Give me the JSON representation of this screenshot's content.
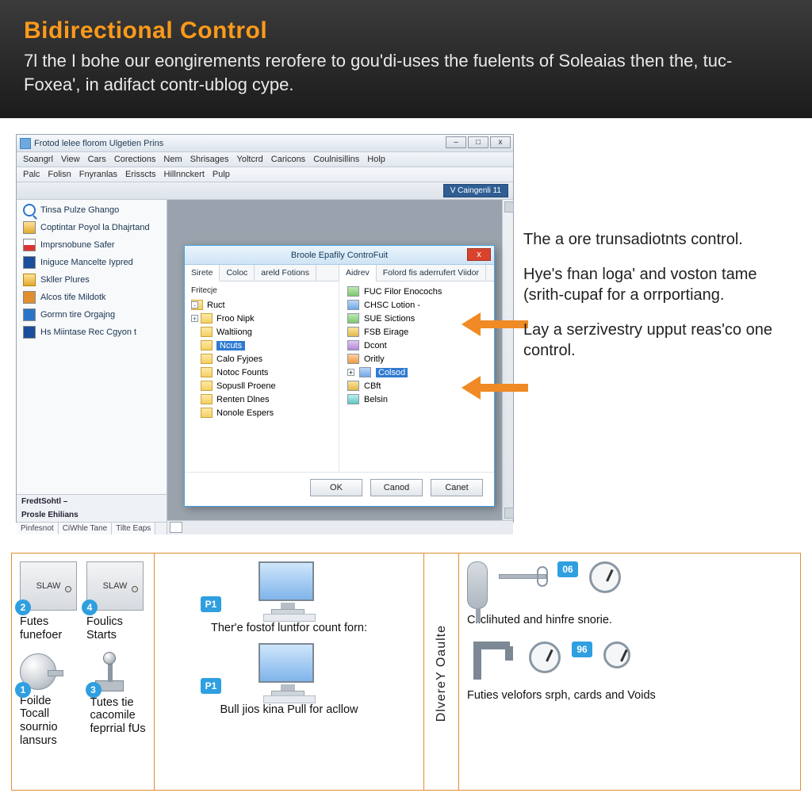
{
  "hero": {
    "title": "Bidirectional Control",
    "body": "7l the I bohe our eongirements rerofere to gou'di-uses the fuelents of Soleaias then the, tuc- Foxea', in adifact contr-ublog cype."
  },
  "hostWindow": {
    "title": "Frotod lelee florom Ulgetien Prins",
    "winButtons": {
      "min": "–",
      "max": "□",
      "close": "x"
    },
    "menu": [
      "Soangrl",
      "View",
      "Cars",
      "Corections",
      "Nem",
      "Shrisages",
      "Yoltcrd",
      "Caricons",
      "Coulnisillins",
      "Holp"
    ],
    "innerMenu": [
      "Palc",
      "Folisn",
      "Fnyranlas",
      "Erisscts",
      "Hillnnckert",
      "Pulp"
    ],
    "categoryBtn": "V Caingenli  11",
    "side": [
      "Tinsa Pulze Ghango",
      "Coptintar Poyol la Dhajrtand",
      "Imprsnobune Safer",
      "Iniguce Mancelte Iypred",
      "Skller Plures",
      "Alcos tife Mildotk",
      "Gormn tire Orgajng",
      "Hs Miintase Rec Cgyon t"
    ],
    "sideGroupA": "FredtSohtl –",
    "sideGroupB": "Prosle Ehilians",
    "sideTabs": [
      "Pinfesnot",
      "CiWhle Tane",
      "Tilte Eaps"
    ]
  },
  "dialog": {
    "title": "Broole Epafily ControFuit",
    "close": "x",
    "leftTabs": [
      "Sirete",
      "Coloc",
      "areld Fotions"
    ],
    "rightTabs": [
      "Aidrev",
      "Folord fis aderrufert Viidor"
    ],
    "leftHeader": "Fritecje",
    "tree": [
      {
        "label": "Ruct",
        "root": true,
        "exp": "-"
      },
      {
        "label": "Froo Nipk",
        "exp": "+"
      },
      {
        "label": "Waltiiong"
      },
      {
        "label": "Ncuts",
        "sel": true
      },
      {
        "label": "Calo Fyjoes"
      },
      {
        "label": "Notoc Founts"
      },
      {
        "label": "Sopusll Proene"
      },
      {
        "label": "Renten Dlnes"
      },
      {
        "label": "Nonole Espers"
      }
    ],
    "list": [
      {
        "label": "FUC Filor Enocochs",
        "cls": "g"
      },
      {
        "label": "CHSC Lotion -",
        "cls": "b"
      },
      {
        "label": "SUE Sictions",
        "cls": "g"
      },
      {
        "label": "FSB Eirage",
        "cls": "y"
      },
      {
        "label": "Dcont",
        "cls": "p"
      },
      {
        "label": "Oritly",
        "cls": "o"
      },
      {
        "label": "Colsod",
        "cls": "b",
        "sel": true,
        "exp": "+"
      },
      {
        "label": "CBft",
        "cls": "y"
      },
      {
        "label": "Belsin",
        "cls": "c"
      }
    ],
    "buttons": {
      "ok": "OK",
      "cancel": "Canod",
      "canet": "Canet"
    }
  },
  "callouts": {
    "p1": "The a ore trunsadiotnts control.",
    "p2": "Hye's fnan loga' and voston tame (srith-cupaf for a orrportiang.",
    "p3": "Lay a serzivestry upput reas'co one control."
  },
  "grid": {
    "tileWord": "SLAW",
    "badges": {
      "a": "2",
      "b": "4",
      "c": "1",
      "d": "3",
      "p": "P1",
      "e": "06",
      "f": "96"
    },
    "caps": {
      "a": "Futes funefoer",
      "b": "Foulics Starts",
      "c": "Foilde Tocall sournio lansurs",
      "d": "Tutes tie cacomile feprrial fUs",
      "m1": "Ther'e fostof luntfor count forn:",
      "m2": "Bull jios kina Pull for acllow",
      "v": "DlvereY Oaulte",
      "r1": "Cliclihuted and hinfre snorie.",
      "r2": "Futies velofors srph, cards and Voids"
    }
  }
}
